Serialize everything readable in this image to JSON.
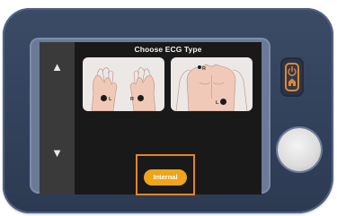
{
  "screen": {
    "title": "Choose ECG Type",
    "nav": {
      "up_icon": "▲",
      "down_icon": "▼"
    },
    "options": [
      {
        "name": "hands",
        "labels": {
          "left": "L",
          "right": "R"
        }
      },
      {
        "name": "chest",
        "labels": {
          "right_arm": "R",
          "left_leg": "L"
        }
      }
    ],
    "button_label": "Internal"
  },
  "device": {
    "power_icon": "power-home-icon"
  },
  "colors": {
    "accent": "#eea51a",
    "highlight": "#e2862a",
    "device_body": "#34435e",
    "screen_bg": "#191919"
  }
}
